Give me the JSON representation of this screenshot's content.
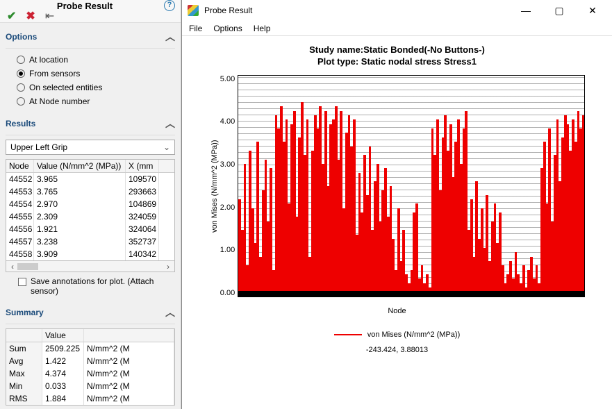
{
  "left": {
    "title": "Probe Result",
    "options_label": "Options",
    "options": [
      {
        "label": "At location",
        "selected": false
      },
      {
        "label": "From sensors",
        "selected": true
      },
      {
        "label": "On selected entities",
        "selected": false
      },
      {
        "label": "At Node number",
        "selected": false
      }
    ],
    "results_label": "Results",
    "combo_value": "Upper Left Grip",
    "grid_headers": {
      "node": "Node",
      "value": "Value (N/mm^2 (MPa))",
      "x": "X (mm"
    },
    "grid_rows": [
      {
        "node": "44552",
        "value": "3.965",
        "x": "109570"
      },
      {
        "node": "44553",
        "value": "3.765",
        "x": "293663"
      },
      {
        "node": "44554",
        "value": "2.970",
        "x": "104869"
      },
      {
        "node": "44555",
        "value": "2.309",
        "x": "324059"
      },
      {
        "node": "44556",
        "value": "1.921",
        "x": "324064"
      },
      {
        "node": "44557",
        "value": "3.238",
        "x": "352737"
      },
      {
        "node": "44558",
        "value": "3.909",
        "x": "140342"
      }
    ],
    "save_annotations_label": "Save annotations for plot. (Attach sensor)",
    "summary_label": "Summary",
    "summary_headers": {
      "blank": "",
      "value": "Value",
      "unit": ""
    },
    "summary_rows": [
      {
        "label": "Sum",
        "value": "2509.225",
        "unit": "N/mm^2 (M"
      },
      {
        "label": "Avg",
        "value": "1.422",
        "unit": "N/mm^2 (M"
      },
      {
        "label": "Max",
        "value": "4.374",
        "unit": "N/mm^2 (M"
      },
      {
        "label": "Min",
        "value": "0.033",
        "unit": "N/mm^2 (M"
      },
      {
        "label": "RMS",
        "value": "1.884",
        "unit": "N/mm^2 (M"
      }
    ]
  },
  "right": {
    "title": "Probe Result",
    "menus": [
      "File",
      "Options",
      "Help"
    ],
    "chart_title_1": "Study name:Static Bonded(-No Buttons-)",
    "chart_title_2": "Plot type: Static nodal stress Stress1",
    "ylabel": "von Mises (N/mm^2 (MPa))",
    "xlabel": "Node",
    "legend": "von Mises (N/mm^2 (MPa))",
    "cursor": "-243.424, 3.88013",
    "yticks": [
      "5.00",
      "4.00",
      "3.00",
      "2.00",
      "1.00",
      "0.00"
    ]
  },
  "chart_data": {
    "type": "line",
    "title": "Plot type: Static nodal stress Stress1",
    "xlabel": "Node",
    "ylabel": "von Mises (N/mm^2 (MPa))",
    "ylim": [
      0,
      5
    ],
    "series": [
      {
        "name": "von Mises (N/mm^2 (MPa))",
        "values": [
          2.2,
          1.5,
          3.0,
          0.7,
          3.3,
          2.0,
          1.2,
          3.5,
          0.9,
          2.4,
          3.1,
          1.7,
          2.9,
          0.6,
          4.1,
          3.8,
          4.3,
          3.5,
          4.0,
          2.1,
          3.9,
          4.2,
          1.8,
          3.6,
          4.4,
          3.2,
          4.0,
          0.9,
          3.3,
          4.1,
          3.8,
          4.3,
          3.0,
          4.2,
          2.5,
          3.9,
          4.0,
          4.3,
          3.1,
          4.2,
          2.0,
          3.7,
          4.1,
          3.4,
          4.0,
          1.4,
          2.8,
          1.9,
          3.2,
          2.3,
          3.4,
          1.5,
          2.6,
          3.0,
          1.7,
          2.4,
          2.9,
          1.8,
          2.5,
          1.3,
          0.6,
          2.0,
          0.8,
          1.5,
          0.5,
          0.3,
          0.6,
          1.9,
          2.1,
          0.4,
          0.7,
          0.3,
          0.5,
          0.2,
          3.8,
          3.2,
          4.0,
          2.4,
          3.6,
          4.1,
          3.3,
          3.9,
          2.7,
          3.5,
          4.0,
          3.0,
          3.8,
          4.2,
          1.5,
          2.2,
          0.9,
          2.6,
          1.3,
          2.0,
          1.1,
          2.3,
          0.8,
          1.7,
          2.1,
          1.2,
          1.9,
          0.7,
          0.3,
          0.5,
          0.8,
          0.4,
          1.0,
          0.5,
          0.3,
          0.7,
          0.2,
          0.6,
          0.9,
          0.4,
          0.7,
          0.3,
          2.9,
          3.5,
          2.1,
          3.8,
          1.7,
          3.2,
          4.0,
          2.6,
          3.6,
          4.1,
          3.9,
          3.3,
          4.0,
          3.5,
          4.2,
          3.8,
          4.1
        ]
      }
    ]
  }
}
